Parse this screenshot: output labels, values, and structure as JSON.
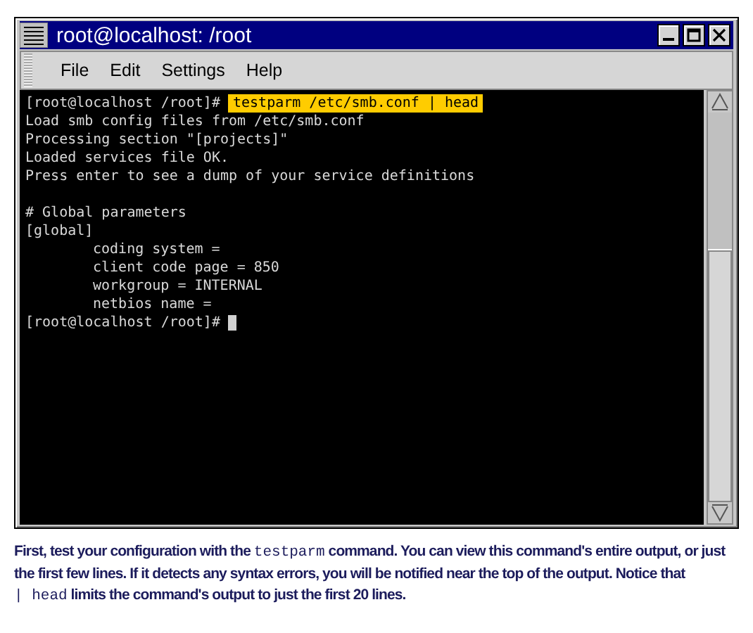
{
  "window": {
    "title": "root@localhost: /root"
  },
  "menu": [
    "File",
    "Edit",
    "Settings",
    "Help"
  ],
  "terminal": {
    "lines": [
      {
        "kind": "command",
        "prompt": "[root@localhost /root]#",
        "command": "testparm /etc/smb.conf | head"
      },
      {
        "kind": "output",
        "text": "Load smb config files from /etc/smb.conf"
      },
      {
        "kind": "output",
        "text": "Processing section \"[projects]\""
      },
      {
        "kind": "output",
        "text": "Loaded services file OK."
      },
      {
        "kind": "output",
        "text": "Press enter to see a dump of your service definitions"
      },
      {
        "kind": "blank"
      },
      {
        "kind": "output",
        "text": "# Global parameters"
      },
      {
        "kind": "output",
        "text": "[global]"
      },
      {
        "kind": "indented",
        "text": "coding system ="
      },
      {
        "kind": "indented",
        "text": "client code page = 850"
      },
      {
        "kind": "indented",
        "text": "workgroup = INTERNAL"
      },
      {
        "kind": "indented",
        "text": "netbios name ="
      },
      {
        "kind": "prompt",
        "prompt": "[root@localhost /root]#",
        "cursor": true
      }
    ]
  },
  "caption": [
    {
      "kind": "text",
      "text": "First, test your configuration with the "
    },
    {
      "kind": "code",
      "text": "testparm"
    },
    {
      "kind": "text",
      "text": " command. You can view this command's entire output, or just the first few lines. If it detects any syntax errors, you will be notified near the top of the output. Notice that "
    },
    {
      "kind": "code",
      "text": "| head"
    },
    {
      "kind": "text",
      "text": " limits the command's output to just the first 20 lines."
    }
  ]
}
